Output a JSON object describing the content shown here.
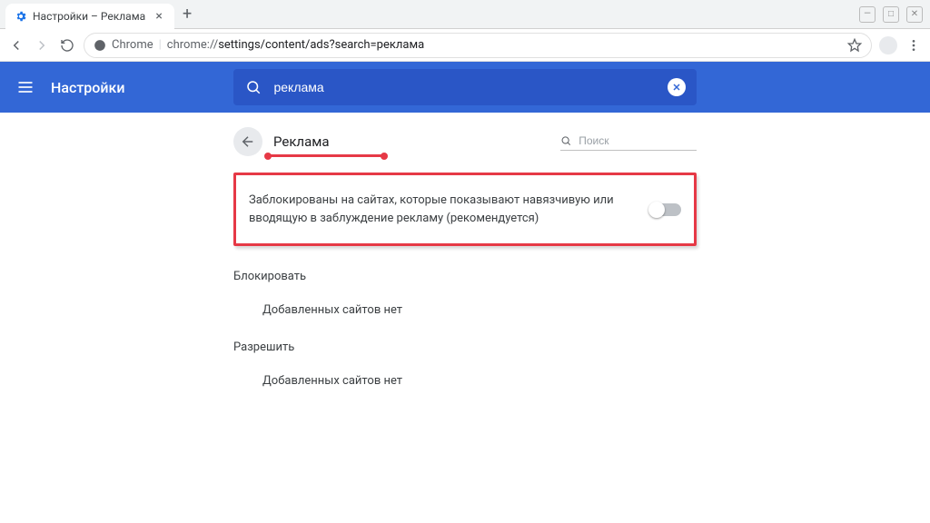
{
  "browser": {
    "tab_title": "Настройки – Реклама",
    "url_prefix": "Chrome",
    "url_origin": "chrome://",
    "url_path": "settings/content/ads?search=реклама"
  },
  "bluebar": {
    "title": "Настройки",
    "search_value": "реклама"
  },
  "page": {
    "title": "Реклама",
    "search_placeholder": "Поиск",
    "toggle_label": "Заблокированы на сайтах, которые показывают навязчивую или вводящую в заблуждение рекламу (рекомендуется)"
  },
  "sections": {
    "block_title": "Блокировать",
    "block_empty": "Добавленных сайтов нет",
    "allow_title": "Разрешить",
    "allow_empty": "Добавленных сайтов нет"
  }
}
